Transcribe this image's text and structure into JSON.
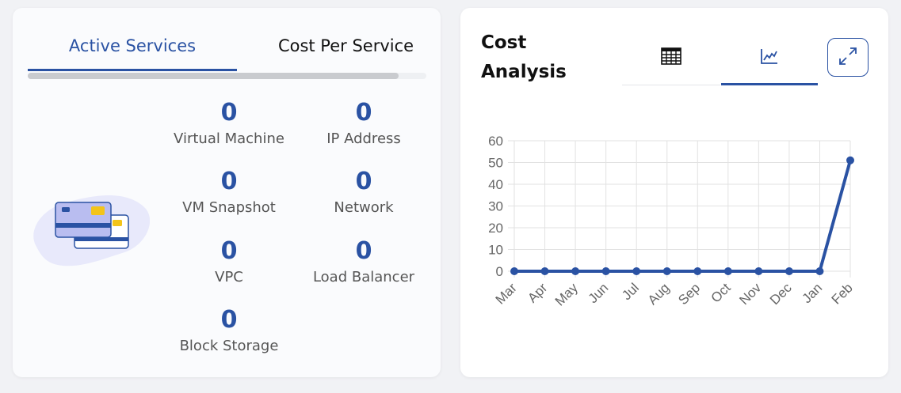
{
  "services_panel": {
    "tabs": [
      {
        "label": "Active Services",
        "active": true
      },
      {
        "label": "Cost Per Service",
        "active": false
      }
    ],
    "stats": [
      {
        "value": "0",
        "label": "Virtual Machine"
      },
      {
        "value": "0",
        "label": "IP Address"
      },
      {
        "value": "0",
        "label": "VM Snapshot"
      },
      {
        "value": "0",
        "label": "Network"
      },
      {
        "value": "0",
        "label": "VPC"
      },
      {
        "value": "0",
        "label": "Load Balancer"
      },
      {
        "value": "0",
        "label": "Block Storage"
      }
    ],
    "illustration_icon": "credit-cards-icon"
  },
  "cost_panel": {
    "title": "Cost Analysis",
    "view_toggles": [
      {
        "icon": "table-icon",
        "active": false
      },
      {
        "icon": "line-chart-icon",
        "active": true
      }
    ],
    "expand_icon": "expand-icon"
  },
  "colors": {
    "accent": "#2a52a3",
    "text_muted": "#555555"
  },
  "chart_data": {
    "type": "line",
    "categories": [
      "Mar",
      "Apr",
      "May",
      "Jun",
      "Jul",
      "Aug",
      "Sep",
      "Oct",
      "Nov",
      "Dec",
      "Jan",
      "Feb"
    ],
    "series": [
      {
        "values": [
          0,
          0,
          0,
          0,
          0,
          0,
          0,
          0,
          0,
          0,
          0,
          51
        ],
        "color": "#2a52a3"
      }
    ],
    "ylim": [
      0,
      60
    ],
    "yticks": [
      0,
      10,
      20,
      30,
      40,
      50,
      60
    ],
    "grid": true,
    "title": "",
    "xlabel": "",
    "ylabel": ""
  }
}
